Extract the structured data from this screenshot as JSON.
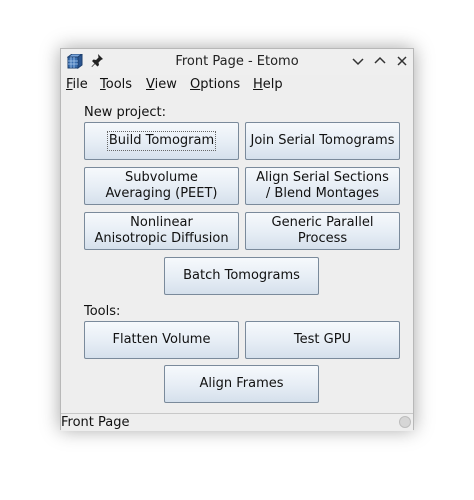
{
  "window": {
    "title": "Front Page - Etomo",
    "icons": {
      "app": "etomo-cube-icon",
      "pin": "pin-icon",
      "minimize": "chevron-down-icon",
      "maximize": "chevron-up-icon",
      "close": "close-icon"
    }
  },
  "menubar": {
    "items": [
      {
        "mnemonic": "F",
        "rest": "ile"
      },
      {
        "mnemonic": "T",
        "rest": "ools"
      },
      {
        "mnemonic": "V",
        "rest": "iew"
      },
      {
        "mnemonic": "O",
        "rest": "ptions"
      },
      {
        "mnemonic": "H",
        "rest": "elp"
      }
    ]
  },
  "new_project": {
    "label": "New project:",
    "build_tomogram": "Build Tomogram",
    "join_serial_tomograms": "Join Serial Tomograms",
    "subvolume_line1": "Subvolume",
    "subvolume_line2": "Averaging (PEET)",
    "align_serial_line1": "Align Serial Sections",
    "align_serial_line2": "/ Blend Montages",
    "nonlinear_line1": "Nonlinear",
    "nonlinear_line2": "Anisotropic Diffusion",
    "generic_line1": "Generic Parallel",
    "generic_line2": "Process",
    "batch_tomograms": "Batch Tomograms"
  },
  "tools": {
    "label": "Tools:",
    "flatten_volume": "Flatten Volume",
    "test_gpu": "Test GPU",
    "align_frames": "Align Frames"
  },
  "status": {
    "text": "Front Page"
  },
  "colors": {
    "button_border": "#7a8a9b",
    "button_top": "#f6f9fc",
    "button_bottom": "#d5e0ec",
    "panel": "#eeeeee"
  }
}
